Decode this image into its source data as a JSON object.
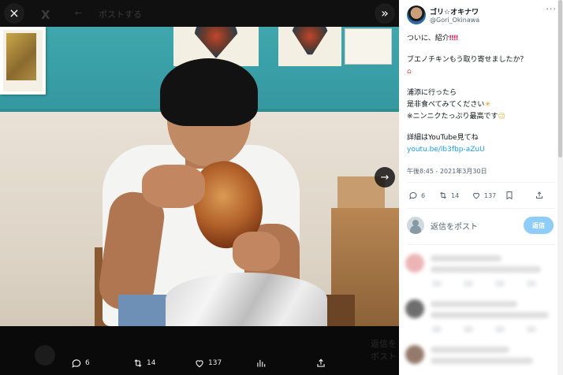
{
  "viewer": {
    "close_label": "×",
    "expand_label": "»",
    "next_label": "→",
    "top_ghost": [
      "ポストする"
    ],
    "photo_alt": "",
    "bottom_ghost": [
      "",
      "返信をポスト"
    ],
    "actions": [
      {
        "name": "reply",
        "icon": "comment-icon",
        "count": "6"
      },
      {
        "name": "retweet",
        "icon": "retweet-icon",
        "count": "14"
      },
      {
        "name": "like",
        "icon": "heart-icon",
        "count": "137"
      },
      {
        "name": "views",
        "icon": "bar-chart-icon",
        "count": ""
      },
      {
        "name": "share",
        "icon": "share-icon",
        "count": ""
      }
    ]
  },
  "tweet": {
    "author_name": "ゴリ☆オキナワ",
    "author_handle": "@Gori_Okinawa",
    "more_label": "···",
    "lines": [
      "ついに、紹介",
      "",
      "ブエノチキンもう取り寄せましたか？",
      "",
      "浦添に行ったら",
      "是非食べてみてください",
      "※ニンニクたっぷり最高です",
      "",
      "詳細はYouTube見てね"
    ],
    "link": "youtu.be/lb3fbp-aZuU",
    "timestamp": "午後8:45 - 2021年3月30日",
    "stats": {
      "replies": "6",
      "retweets": "14",
      "likes": "137"
    },
    "reply_placeholder": "返信をポスト",
    "reply_button": "返信"
  },
  "colors": {
    "accent": "#1d9bf0",
    "reply_button_disabled": "#8ecdf8",
    "text_primary": "#0f1419",
    "text_secondary": "#536471",
    "viewer_bg": "#000000"
  }
}
